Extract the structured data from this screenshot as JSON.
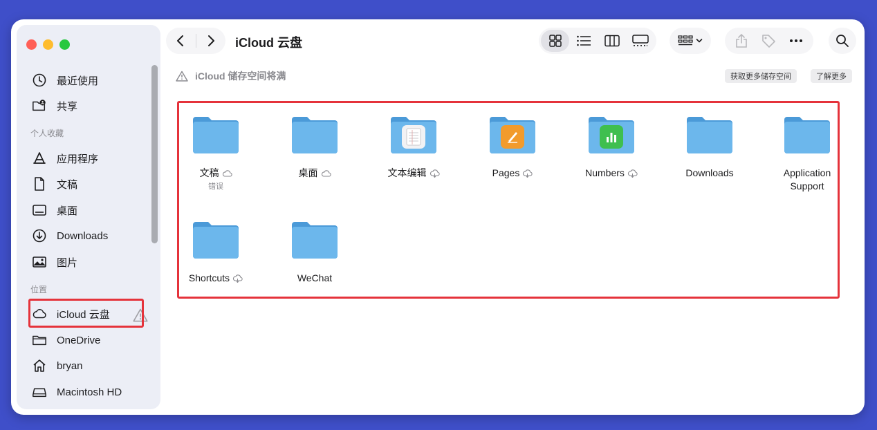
{
  "window": {
    "title": "iCloud 云盘"
  },
  "sidebar": {
    "favorites_label": "个人收藏",
    "locations_label": "位置",
    "top_items": [
      {
        "label": "最近使用",
        "icon": "clock-icon"
      },
      {
        "label": "共享",
        "icon": "shared-folder-icon"
      }
    ],
    "favorites": [
      {
        "label": "应用程序",
        "icon": "applications-icon"
      },
      {
        "label": "文稿",
        "icon": "document-icon"
      },
      {
        "label": "桌面",
        "icon": "desktop-icon"
      },
      {
        "label": "Downloads",
        "icon": "download-icon"
      },
      {
        "label": "图片",
        "icon": "photo-icon"
      }
    ],
    "locations": [
      {
        "label": "iCloud 云盘",
        "icon": "cloud-icon",
        "selected": true,
        "warning": true
      },
      {
        "label": "OneDrive",
        "icon": "folder-icon"
      },
      {
        "label": "bryan",
        "icon": "home-icon"
      },
      {
        "label": "Macintosh HD",
        "icon": "disk-icon"
      }
    ]
  },
  "banner": {
    "text": "iCloud 储存空间将满",
    "buy_more_label": "获取更多储存空间",
    "learn_more_label": "了解更多"
  },
  "files": [
    {
      "name": "文稿",
      "status": "错误",
      "cloud": "cloud-icon",
      "badge": null
    },
    {
      "name": "桌面",
      "cloud": "cloud-icon",
      "badge": null
    },
    {
      "name": "文本编辑",
      "cloud": "cloud-download-icon",
      "badge": "textedit-icon"
    },
    {
      "name": "Pages",
      "cloud": "cloud-download-icon",
      "badge": "pages-icon"
    },
    {
      "name": "Numbers",
      "cloud": "cloud-download-icon",
      "badge": "numbers-icon"
    },
    {
      "name": "Downloads",
      "cloud": null,
      "badge": null
    },
    {
      "name": "Application Support",
      "cloud": null,
      "badge": null
    },
    {
      "name": "Shortcuts",
      "cloud": "cloud-download-icon",
      "badge": null
    },
    {
      "name": "WeChat",
      "cloud": null,
      "badge": null
    }
  ],
  "colors": {
    "background": "#3f4fc9",
    "highlight": "#e5333b",
    "folder": "#5aa7e3",
    "sidebar": "#eceef6"
  }
}
